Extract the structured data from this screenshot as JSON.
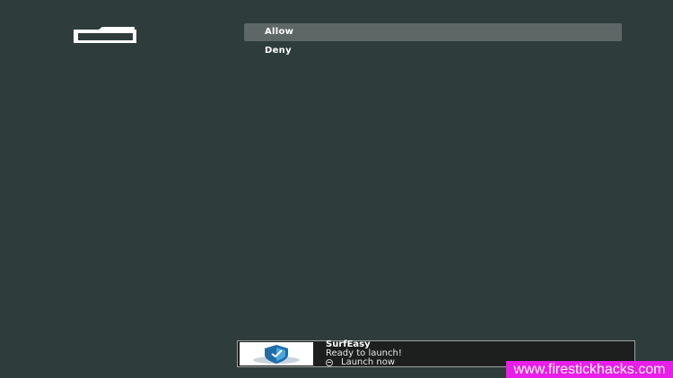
{
  "menu": {
    "items": [
      {
        "label": "Allow",
        "selected": true
      },
      {
        "label": "Deny",
        "selected": false
      }
    ]
  },
  "icons": {
    "header": "folder-icon",
    "toast_thumbnail": "surfeasy-shield-logo-icon",
    "toast_action": "menu-button-icon"
  },
  "toast": {
    "title": "SurfEasy",
    "subtitle": "Ready to launch!",
    "action_label": "Launch now"
  },
  "watermark": {
    "text": "www.firestickhacks.com"
  },
  "colors": {
    "background": "#2e3d3b",
    "selected_item": "#5d6866",
    "toast_background": "#1d1f1f",
    "watermark_background": "#e91ee9"
  }
}
